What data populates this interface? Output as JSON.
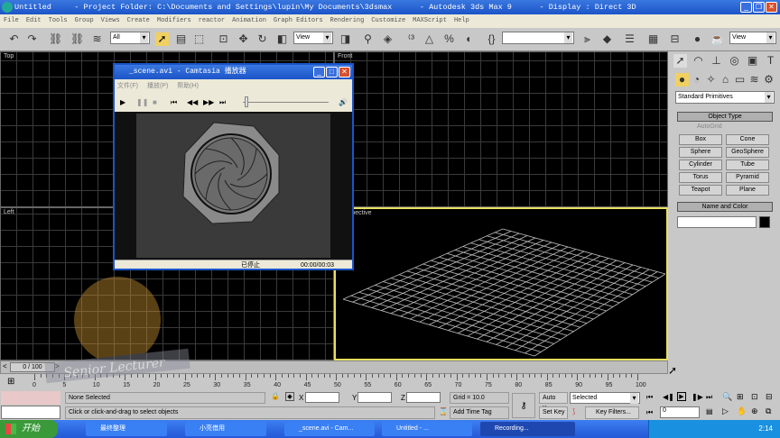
{
  "title": {
    "text": "Untitled     - Project Folder: C:\\Documents and Settings\\lupin\\My Documents\\3dsmax      - Autodesk 3ds Max 9      - Display : Direct 3D"
  },
  "menu": [
    "File",
    "Edit",
    "Tools",
    "Group",
    "Views",
    "Create",
    "Modifiers",
    "reactor",
    "Animation",
    "Graph Editors",
    "Rendering",
    "Customize",
    "MAXScript",
    "Help"
  ],
  "toolbar": {
    "selection_filter": "All",
    "ref_coord": "View",
    "named_sel": "",
    "view2": "View"
  },
  "viewports": {
    "top": "Top",
    "front": "Front",
    "left": "Left",
    "perspective": "Perspective"
  },
  "panel": {
    "category": "Standard Primitives",
    "object_type": "Object Type",
    "autogrid": "AutoGrid",
    "buttons": [
      "Box",
      "Cone",
      "Sphere",
      "GeoSphere",
      "Cylinder",
      "Tube",
      "Torus",
      "Pyramid",
      "Teapot",
      "Plane"
    ],
    "name_color": "Name and Color",
    "name_value": ""
  },
  "player": {
    "title": "_scene.avi - Camtasia 播放器",
    "menu": [
      "文件(F)",
      "播放(P)",
      "帮助(H)"
    ],
    "status": "已停止",
    "time": "00:00/00:03"
  },
  "timeline": {
    "slider": "0 / 100",
    "ticks": [
      "0",
      "5",
      "10",
      "15",
      "20",
      "25",
      "30",
      "35",
      "40",
      "45",
      "50",
      "55",
      "60",
      "65",
      "70",
      "75",
      "80",
      "85",
      "90",
      "95",
      "100"
    ]
  },
  "status": {
    "selection": "None Selected",
    "prompt": "Click or click-and-drag to select objects",
    "x_label": "X",
    "y_label": "Y",
    "z_label": "Z",
    "grid": "Grid = 10.0",
    "add_time_tag": "Add Time Tag",
    "auto_key": "Auto Key",
    "set_key": "Set Key",
    "key_mode": "Selected",
    "key_filters": "Key Filters...",
    "frame": "0"
  },
  "watermark": {
    "text": "Senior Lecturer"
  },
  "taskbar": {
    "start": "开始",
    "tasks": [
      "最终整理",
      "小亮借用",
      "_scene.avi - Cam...",
      "Untitled      - ...",
      "Recording..."
    ],
    "clock": "2:14"
  },
  "colors": {
    "active_viewport": "#e8e060",
    "titlebar": "#1c54c8"
  }
}
